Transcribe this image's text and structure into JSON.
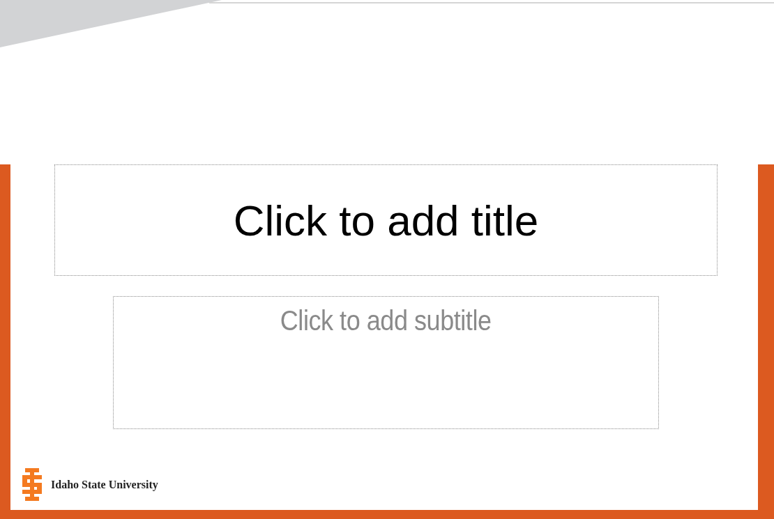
{
  "slide": {
    "title_box": {
      "text": "Click to add title"
    },
    "subtitle_box": {
      "text": "Click to add subtitle"
    },
    "footer": {
      "text": "Idaho State University"
    }
  }
}
